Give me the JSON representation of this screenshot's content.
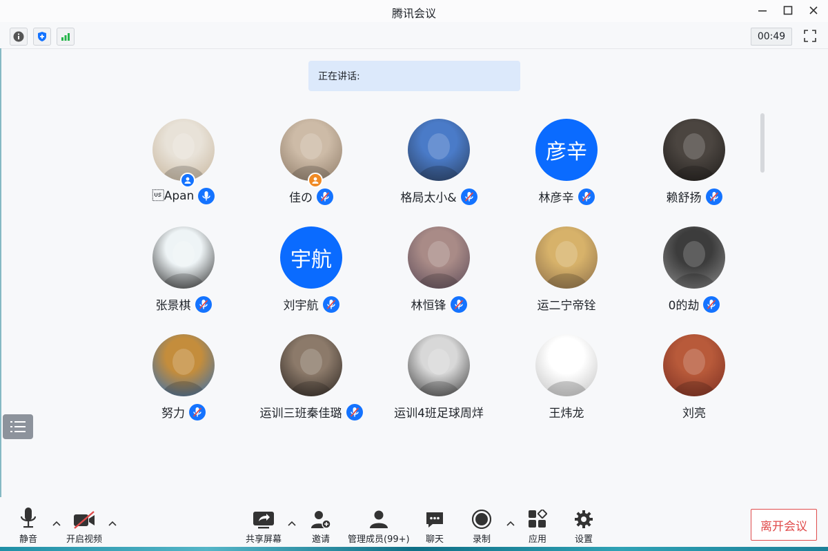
{
  "window": {
    "title": "腾讯会议"
  },
  "top_toolbar": {
    "timer": "00:49"
  },
  "speaking_banner": {
    "label": "正在讲话:"
  },
  "participants": [
    {
      "name": "\u001fApan",
      "avatar": "photo",
      "mic": "on",
      "badge": "host"
    },
    {
      "name": "佳の",
      "avatar": "photo",
      "mic": "muted",
      "badge": "cohost"
    },
    {
      "name": "格局太小&",
      "avatar": "photo",
      "mic": "muted"
    },
    {
      "name": "林彦辛",
      "avatar_text": "彦辛",
      "mic": "muted"
    },
    {
      "name": "赖舒扬",
      "avatar": "photo",
      "mic": "muted"
    },
    {
      "name": "张景棋",
      "avatar": "photo",
      "mic": "muted"
    },
    {
      "name": "刘宇航",
      "avatar_text": "宇航",
      "mic": "muted"
    },
    {
      "name": "林恒锋",
      "avatar": "photo",
      "mic": "muted"
    },
    {
      "name": "运二宁帝铨",
      "avatar": "photo",
      "mic": "none"
    },
    {
      "name": "0的劫",
      "avatar": "photo",
      "mic": "muted"
    },
    {
      "name": "努力",
      "avatar": "photo",
      "mic": "muted"
    },
    {
      "name": "运训三班秦佳璐",
      "avatar": "photo",
      "mic": "muted"
    },
    {
      "name": "运训4班足球周烊",
      "avatar": "photo",
      "mic": "none"
    },
    {
      "name": "王炜龙",
      "avatar": "photo",
      "mic": "none"
    },
    {
      "name": "刘亮",
      "avatar": "photo",
      "mic": "none"
    }
  ],
  "bottom_toolbar": {
    "mute": "静音",
    "video": "开启视频",
    "share": "共享屏幕",
    "invite": "邀请",
    "members": "管理成员(99+)",
    "chat": "聊天",
    "record": "录制",
    "apps": "应用",
    "settings": "设置",
    "leave": "离开会议"
  },
  "colors": {
    "accent": "#0a6bff",
    "leave": "#e04b4b",
    "banner": "#dce9fb"
  }
}
